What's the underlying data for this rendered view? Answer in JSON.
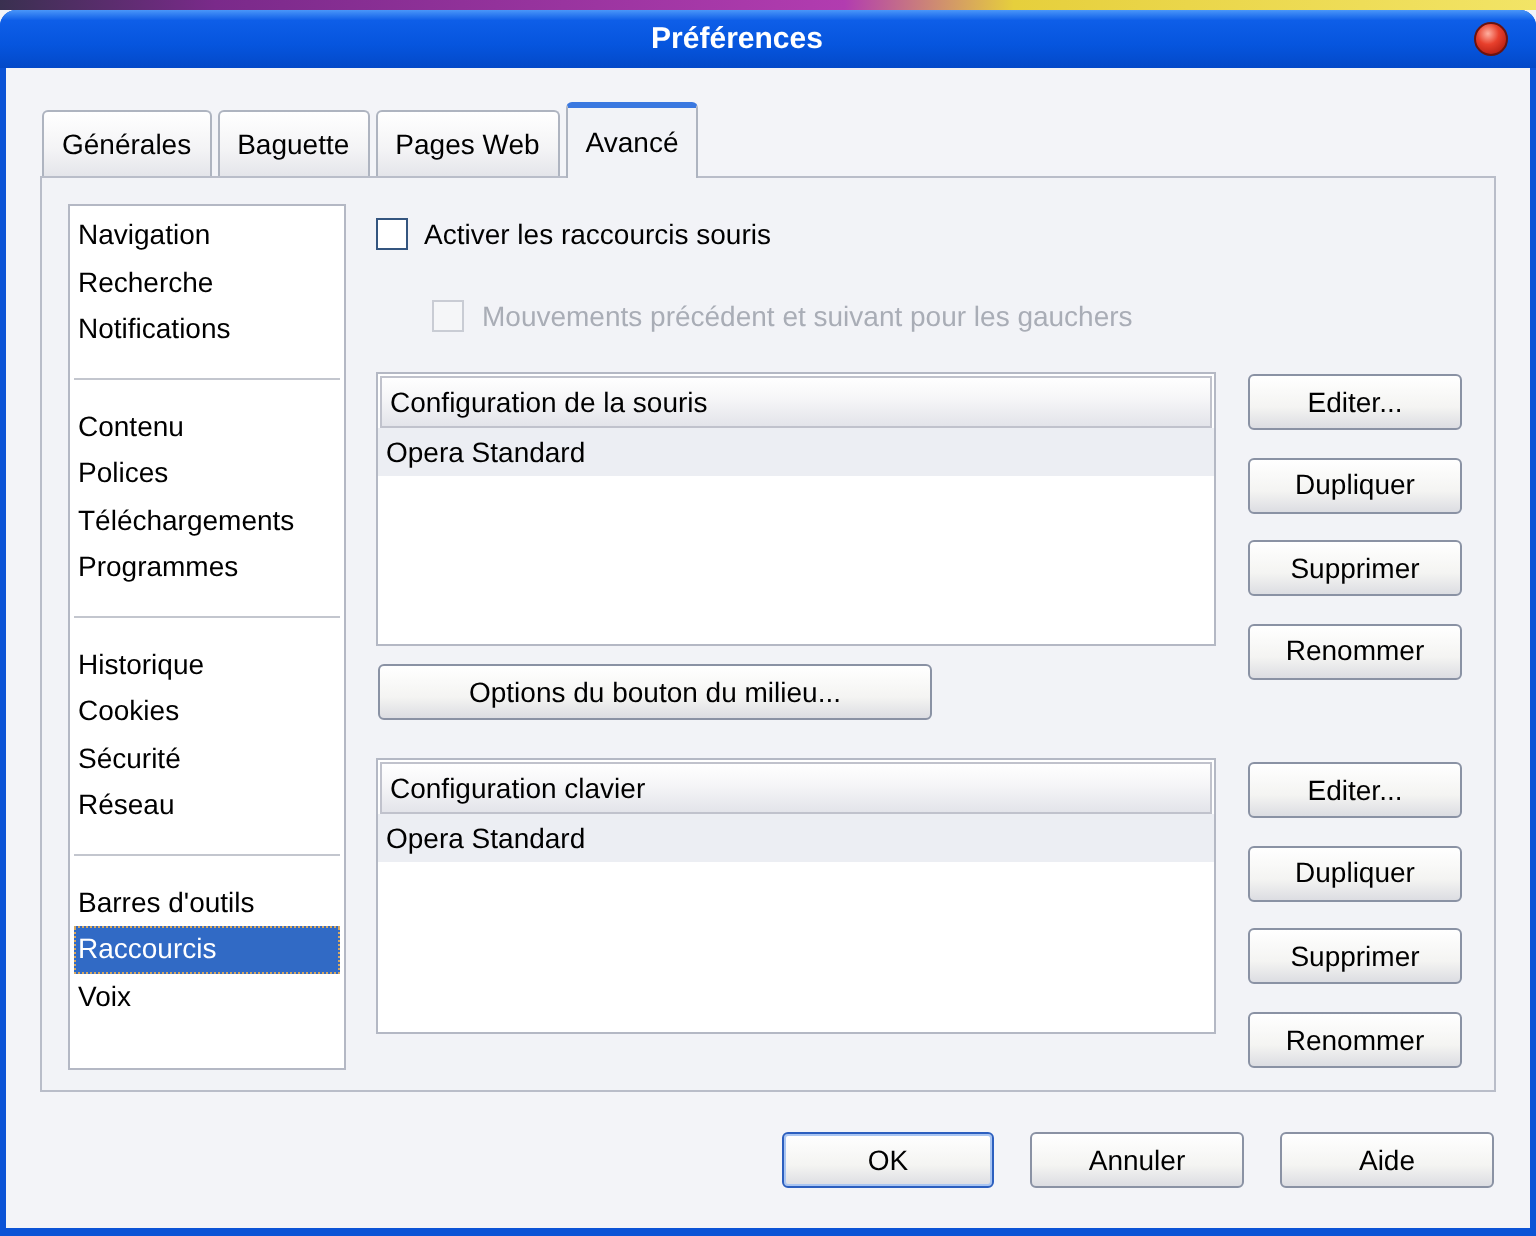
{
  "window": {
    "title": "Préférences"
  },
  "tabs": [
    {
      "label": "Générales",
      "selected": false
    },
    {
      "label": "Baguette",
      "selected": false
    },
    {
      "label": "Pages Web",
      "selected": false
    },
    {
      "label": "Avancé",
      "selected": true
    }
  ],
  "sidebar": {
    "groups": [
      {
        "items": [
          {
            "label": "Navigation",
            "selected": false
          },
          {
            "label": "Recherche",
            "selected": false
          },
          {
            "label": "Notifications",
            "selected": false
          }
        ]
      },
      {
        "items": [
          {
            "label": "Contenu",
            "selected": false
          },
          {
            "label": "Polices",
            "selected": false
          },
          {
            "label": "Téléchargements",
            "selected": false
          },
          {
            "label": "Programmes",
            "selected": false
          }
        ]
      },
      {
        "items": [
          {
            "label": "Historique",
            "selected": false
          },
          {
            "label": "Cookies",
            "selected": false
          },
          {
            "label": "Sécurité",
            "selected": false
          },
          {
            "label": "Réseau",
            "selected": false
          }
        ]
      },
      {
        "items": [
          {
            "label": "Barres d'outils",
            "selected": false
          },
          {
            "label": "Raccourcis",
            "selected": true
          },
          {
            "label": "Voix",
            "selected": false
          }
        ]
      }
    ]
  },
  "options": [
    {
      "label": "Activer les raccourcis souris",
      "checked": false,
      "disabled": false,
      "children": [
        {
          "label": "Mouvements précédent et suivant pour les gauchers",
          "checked": false,
          "disabled": true
        }
      ]
    }
  ],
  "mouse_configuration": {
    "header": "Configuration de la souris",
    "rows": [
      {
        "label": "Opera Standard",
        "selected": true
      }
    ],
    "buttons": [
      "Editer...",
      "Dupliquer",
      "Supprimer",
      "Renommer"
    ]
  },
  "middle_button": "Options du bouton du milieu...",
  "keyboard_configuration": {
    "header": "Configuration clavier",
    "rows": [
      {
        "label": "Opera Standard",
        "selected": true
      }
    ],
    "buttons": [
      "Editer...",
      "Dupliquer",
      "Supprimer",
      "Renommer"
    ]
  },
  "dialog_buttons": [
    {
      "label": "OK",
      "default": true
    },
    {
      "label": "Annuler",
      "default": false
    },
    {
      "label": "Aide",
      "default": false
    }
  ]
}
